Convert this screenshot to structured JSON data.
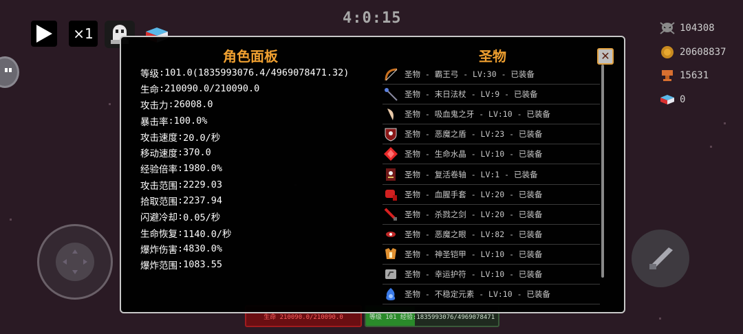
{
  "hud": {
    "timer": "4:0:15",
    "speed_label": "×1"
  },
  "resources": [
    {
      "icon": "skull-icon",
      "value": "104308"
    },
    {
      "icon": "gold-coin-icon",
      "value": "20608837"
    },
    {
      "icon": "trophy-icon",
      "value": "15631"
    },
    {
      "icon": "chest-icon",
      "value": "0"
    }
  ],
  "character_panel": {
    "title": "角色面板",
    "stats": [
      {
        "label": "等级",
        "value": "101.0(1835993076.4/4969078471.32)"
      },
      {
        "label": "生命",
        "value": "210090.0/210090.0"
      },
      {
        "label": "攻击力",
        "value": "26008.0"
      },
      {
        "label": "暴击率",
        "value": "100.0%"
      },
      {
        "label": "攻击速度",
        "value": "20.0/秒"
      },
      {
        "label": "移动速度",
        "value": "370.0"
      },
      {
        "label": "经验倍率",
        "value": "1980.0%"
      },
      {
        "label": "攻击范围",
        "value": "2229.03"
      },
      {
        "label": "拾取范围",
        "value": "2237.94"
      },
      {
        "label": "闪避冷却",
        "value": "0.05/秒"
      },
      {
        "label": "生命恢复",
        "value": "1140.0/秒"
      },
      {
        "label": "爆炸伤害",
        "value": "4830.0%"
      },
      {
        "label": "爆炸范围",
        "value": "1083.55"
      }
    ]
  },
  "relic_panel": {
    "title": "圣物",
    "items": [
      {
        "icon": "bow-icon",
        "text": "圣物 - 霸王弓 - LV:30 - 已装备"
      },
      {
        "icon": "staff-icon",
        "text": "圣物 - 末日法杖 - LV:9 - 已装备"
      },
      {
        "icon": "fang-icon",
        "text": "圣物 - 吸血鬼之牙 - LV:10 - 已装备"
      },
      {
        "icon": "shield-icon",
        "text": "圣物 - 恶魔之盾 - LV:23 - 已装备"
      },
      {
        "icon": "crystal-icon",
        "text": "圣物 - 生命水晶 - LV:10 - 已装备"
      },
      {
        "icon": "scroll-icon",
        "text": "圣物 - 复活卷轴 - LV:1 - 已装备"
      },
      {
        "icon": "gauntlet-icon",
        "text": "圣物 - 血腥手套 - LV:20 - 已装备"
      },
      {
        "icon": "sword-icon",
        "text": "圣物 - 杀戮之剑 - LV:20 - 已装备"
      },
      {
        "icon": "eye-icon",
        "text": "圣物 - 恶魔之眼 - LV:82 - 已装备"
      },
      {
        "icon": "armor-icon",
        "text": "圣物 - 神圣铠甲 - LV:10 - 已装备"
      },
      {
        "icon": "charm-icon",
        "text": "圣物 - 幸运护符 - LV:10 - 已装备"
      },
      {
        "icon": "element-icon",
        "text": "圣物 - 不稳定元素 - LV:10 - 已装备"
      }
    ]
  },
  "bars": {
    "hp_text": "生命 210090.0/210090.0",
    "xp_text": "等级 101 经验:1835993076/4969078471",
    "xp_fraction": 0.37
  },
  "colors": {
    "title": "#f0a030",
    "background": "#2a1a24",
    "hp": "#a11b1f",
    "xp": "#2a8a2a"
  }
}
